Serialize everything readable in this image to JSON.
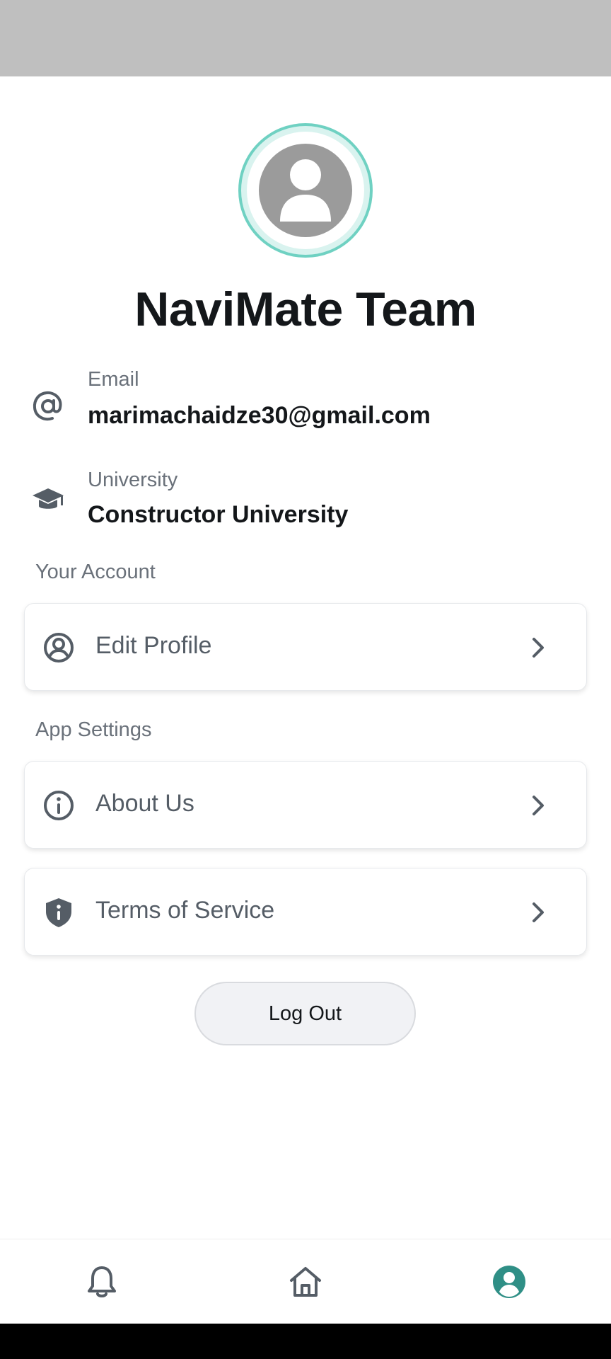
{
  "profile": {
    "name": "NaviMate Team"
  },
  "info": {
    "email_label": "Email",
    "email_value": "marimachaidze30@gmail.com",
    "university_label": "University",
    "university_value": "Constructor University"
  },
  "sections": {
    "account_title": "Your Account",
    "settings_title": "App Settings"
  },
  "menu": {
    "edit_profile": "Edit Profile",
    "about_us": "About Us",
    "terms": "Terms of Service"
  },
  "actions": {
    "logout": "Log Out"
  },
  "bottom_nav": {
    "items": [
      "notifications",
      "home",
      "profile"
    ],
    "active": "profile"
  },
  "colors": {
    "accent": "#2f8f86",
    "avatar_ring": "#6fd1c2",
    "icon_gray": "#555d66"
  },
  "icons": {
    "email": "at-icon",
    "university": "graduation-cap-icon",
    "edit_profile": "user-circle-icon",
    "about_us": "info-icon",
    "terms": "shield-icon"
  }
}
